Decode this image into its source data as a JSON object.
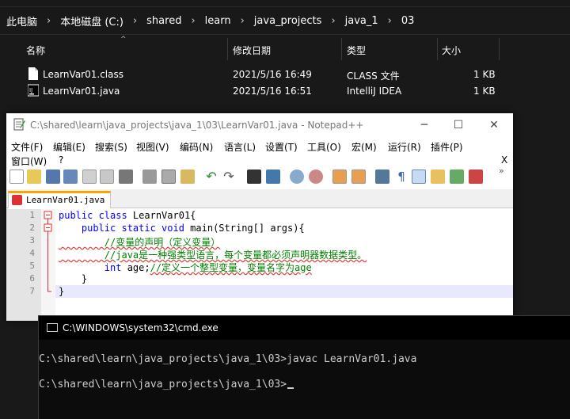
{
  "explorer": {
    "breadcrumb": [
      "此电脑",
      "本地磁盘 (C:)",
      "shared",
      "learn",
      "java_projects",
      "java_1",
      "03"
    ],
    "columns": {
      "name": "名称",
      "modified": "修改日期",
      "type": "类型",
      "size": "大小"
    },
    "files": [
      {
        "name": "LearnVar01.class",
        "modified": "2021/5/16 16:49",
        "type": "CLASS 文件",
        "size": "1 KB",
        "icon": "class-file-icon"
      },
      {
        "name": "LearnVar01.java",
        "modified": "2021/5/16 16:51",
        "type": "IntelliJ IDEA",
        "size": "1 KB",
        "icon": "intellij-file-icon"
      }
    ]
  },
  "notepad": {
    "title": "C:\\shared\\learn\\java_projects\\java_1\\03\\LearnVar01.java - Notepad++",
    "menu_row1": [
      "文件(F)",
      "编辑(E)",
      "搜索(S)",
      "视图(V)",
      "编码(N)",
      "语言(L)",
      "设置(T)",
      "工具(O)",
      "宏(M)",
      "运行(R)",
      "插件(P)"
    ],
    "menu_row2": [
      "窗口(W)",
      "?"
    ],
    "close_doc": "X",
    "tab_label": "LearnVar01.java",
    "line_numbers": [
      "1",
      "2",
      "3",
      "4",
      "5",
      "6",
      "7"
    ],
    "code": {
      "l1_kw": "public class",
      "l1_rest": " LearnVar01{",
      "l2_indent": "    ",
      "l2_kw": "public static void",
      "l2_rest": " main(String[] args){",
      "l3": "        //变量的声明（定义变量）",
      "l4": "        //java是一种强类型语言，每个变量都必须声明器数据类型。",
      "l5_indent": "        ",
      "l5_kw": "int",
      "l5_rest": " age;",
      "l5_comment": "//定义一个整型变量，变量名字为age",
      "l6": "    }",
      "l7": "}"
    },
    "colors": {
      "accent_tab": "#f9a400",
      "keyword": "#7f007f",
      "comment": "#008000"
    }
  },
  "cmd": {
    "title": "C:\\WINDOWS\\system32\\cmd.exe",
    "line1": "C:\\shared\\learn\\java_projects\\java_1\\03>javac LearnVar01.java",
    "line2": "C:\\shared\\learn\\java_projects\\java_1\\03>"
  }
}
